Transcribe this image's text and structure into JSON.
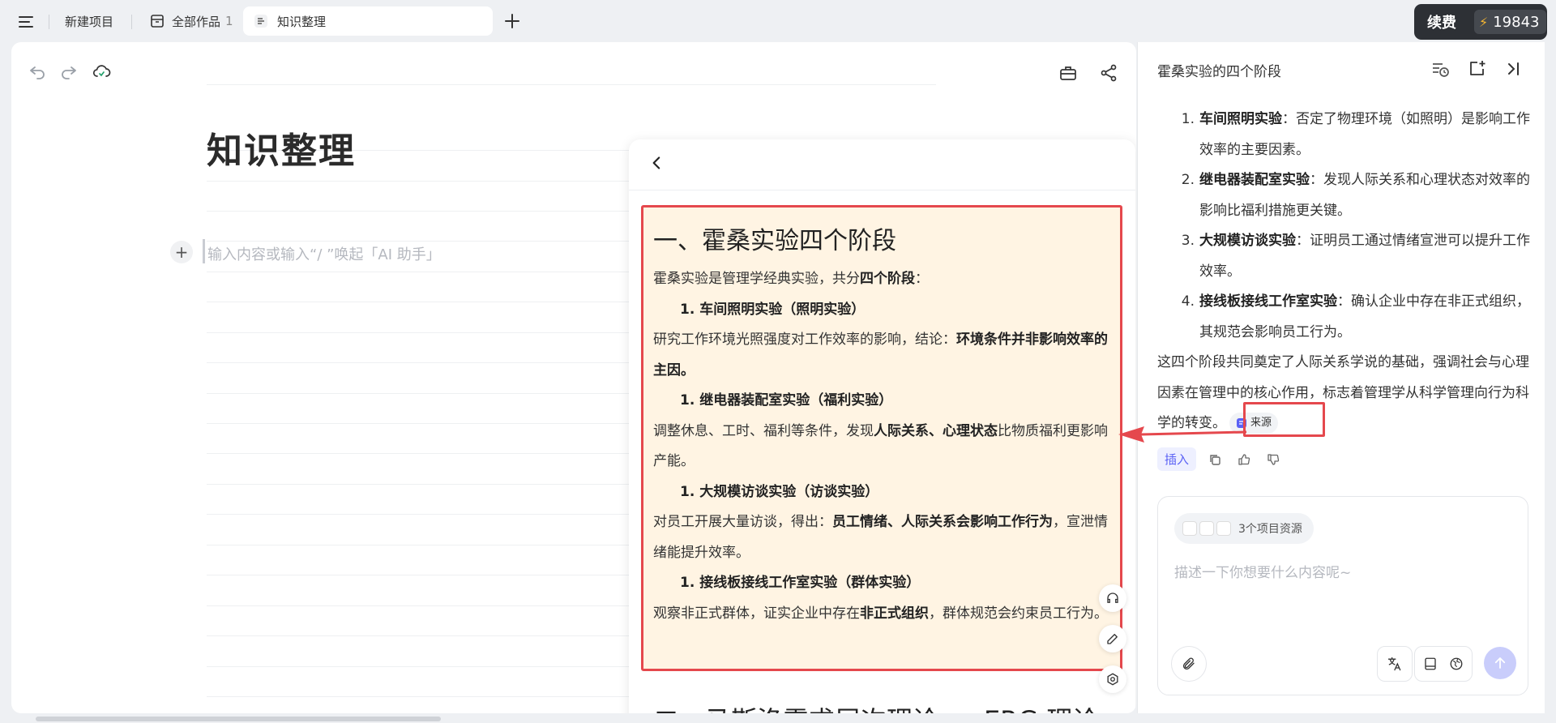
{
  "tabs": {
    "new_project": "新建项目",
    "works_label": "全部作品",
    "works_count": "1",
    "active": "知识整理"
  },
  "account": {
    "renew_label": "续费",
    "credits": "19843"
  },
  "editor": {
    "title": "知识整理",
    "placeholder": "输入内容或输入“/ ”唤起「AI 助手」"
  },
  "card": {
    "h1": "一、霍桑实验四个阶段",
    "intro_pre": "霍桑实验是管理学经典实验，共分",
    "intro_bold": "四个阶段",
    "intro_post": "：",
    "stages": [
      {
        "heading": "1. 车间照明实验（照明实验）",
        "pre": "研究工作环境光照强度对工作效率的影响，结论：",
        "bold": "环境条件并非影响效率的主因。",
        "post": ""
      },
      {
        "heading": "1. 继电器装配室实验（福利实验）",
        "pre": "调整休息、工时、福利等条件，发现",
        "bold": "人际关系、心理状态",
        "post": "比物质福利更影响产能。"
      },
      {
        "heading": "1. 大规模访谈实验（访谈实验）",
        "pre": "对员工开展大量访谈，得出：",
        "bold": "员工情绪、人际关系会影响工作行为",
        "post": "，宣泄情绪能提升效率。"
      },
      {
        "heading": "1. 接线板接线工作室实验（群体实验）",
        "pre": "观察非正式群体，证实企业中存在",
        "bold": "非正式组织",
        "post": "，群体规范会约束员工行为。"
      }
    ],
    "h2": "二、马斯洛需求层次理论 vs ERG 理论"
  },
  "ai": {
    "title": "霍桑实验的四个阶段",
    "items": [
      {
        "num": "1.",
        "bold": "车间照明实验",
        "text": "：否定了物理环境（如照明）是影响工作效率的主要因素。"
      },
      {
        "num": "2.",
        "bold": "继电器装配室实验",
        "text": "：发现人际关系和心理状态对效率的影响比福利措施更关键。"
      },
      {
        "num": "3.",
        "bold": "大规模访谈实验",
        "text": "：证明员工通过情绪宣泄可以提升工作效率。"
      },
      {
        "num": "4.",
        "bold": "接线板接线工作室实验",
        "text": "：确认企业中存在非正式组织，其规范会影响员工行为。"
      }
    ],
    "summary": "这四个阶段共同奠定了人际关系学说的基础，强调社会与心理因素在管理中的核心作用，标志着管理学从科学管理向行为科学的转变。",
    "source_label": "来源",
    "insert_label": "插入",
    "resources_label": "3个项目资源",
    "input_placeholder": "描述一下你想要什么内容呢~"
  },
  "colors": {
    "accent": "#5b62f5",
    "highlight_bg": "#fff4e3",
    "annotation": "#e5484d"
  }
}
